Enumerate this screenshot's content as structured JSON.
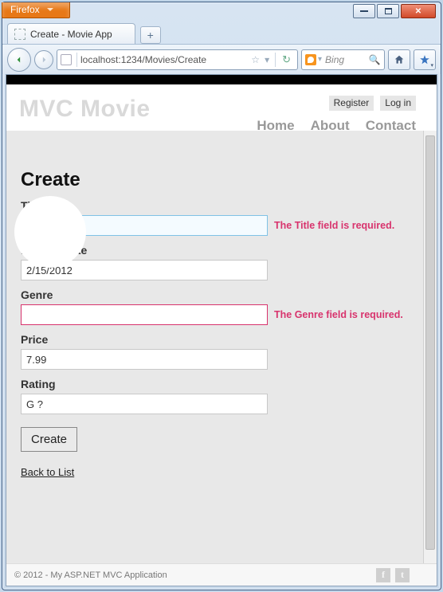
{
  "browser": {
    "appmenu_label": "Firefox",
    "tab_title": "Create - Movie App",
    "url": "localhost:1234/Movies/Create",
    "search_placeholder": "Bing"
  },
  "header": {
    "logo": "MVC Movie",
    "account": {
      "register": "Register",
      "login": "Log in"
    },
    "nav": {
      "home": "Home",
      "about": "About",
      "contact": "Contact"
    }
  },
  "page": {
    "heading": "Create",
    "fields": {
      "title": {
        "label": "Title",
        "value": "",
        "error": "The Title field is required."
      },
      "releaseDate": {
        "label": "ReleaseDate",
        "value": "2/15/2012",
        "error": ""
      },
      "genre": {
        "label": "Genre",
        "value": "",
        "error": "The Genre field is required."
      },
      "price": {
        "label": "Price",
        "value": "7.99",
        "error": ""
      },
      "rating": {
        "label": "Rating",
        "value": "G ?",
        "error": ""
      }
    },
    "submit_label": "Create",
    "back_link": "Back to List"
  },
  "footer": {
    "copyright": "© 2012 - My ASP.NET MVC Application"
  }
}
